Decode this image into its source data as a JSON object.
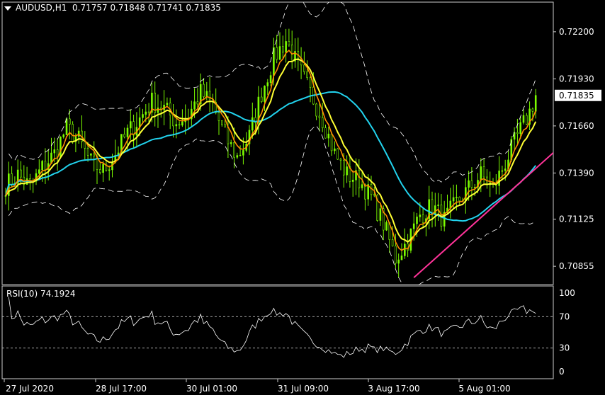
{
  "header": {
    "symbol": "AUDUSD,H1",
    "ohlc": "0.71757 0.71848 0.71741 0.71835"
  },
  "rsi_header": {
    "label": "RSI(10) 74.1924"
  },
  "colors": {
    "background": "#000000",
    "candle": "#7CFC00",
    "ma_fast": "#FF8C00",
    "ma_slow": "#FFFF33",
    "ma_long": "#22D3EE",
    "envelope": "#FFFFFF",
    "trendline": "#FF3399",
    "rsi": "#FFFFFF",
    "price_tag_bg": "#FFFFFF",
    "price_tag_text": "#000000"
  },
  "chart_data": [
    {
      "type": "candlestick",
      "title": "AUDUSD,H1",
      "y_ticks": [
        "0.72200",
        "0.71930",
        "0.71660",
        "0.71390",
        "0.71125",
        "0.70855"
      ],
      "ylim": [
        0.7075,
        0.7237
      ],
      "current_price": "0.71835",
      "x_ticks": [
        "27 Jul 2020",
        "28 Jul 17:00",
        "30 Jul 01:00",
        "31 Jul 09:00",
        "3 Aug 17:00",
        "5 Aug 01:00"
      ],
      "close_path": [
        [
          0,
          0.7132
        ],
        [
          4,
          0.7138
        ],
        [
          8,
          0.7131
        ],
        [
          12,
          0.7142
        ],
        [
          16,
          0.715
        ],
        [
          20,
          0.7165
        ],
        [
          24,
          0.7158
        ],
        [
          28,
          0.7145
        ],
        [
          32,
          0.714
        ],
        [
          36,
          0.715
        ],
        [
          40,
          0.7162
        ],
        [
          44,
          0.717
        ],
        [
          48,
          0.718
        ],
        [
          52,
          0.7176
        ],
        [
          56,
          0.7168
        ],
        [
          60,
          0.7172
        ],
        [
          64,
          0.7185
        ],
        [
          68,
          0.7178
        ],
        [
          72,
          0.716
        ],
        [
          76,
          0.7148
        ],
        [
          80,
          0.716
        ],
        [
          84,
          0.7185
        ],
        [
          88,
          0.7205
        ],
        [
          92,
          0.7215
        ],
        [
          96,
          0.72
        ],
        [
          100,
          0.7185
        ],
        [
          104,
          0.717
        ],
        [
          108,
          0.715
        ],
        [
          112,
          0.7138
        ],
        [
          116,
          0.7135
        ],
        [
          120,
          0.7125
        ],
        [
          124,
          0.711
        ],
        [
          128,
          0.709
        ],
        [
          132,
          0.71
        ],
        [
          136,
          0.7115
        ],
        [
          140,
          0.712
        ],
        [
          144,
          0.7112
        ],
        [
          148,
          0.7122
        ],
        [
          152,
          0.713
        ],
        [
          156,
          0.7138
        ],
        [
          160,
          0.713
        ],
        [
          164,
          0.7145
        ],
        [
          168,
          0.716
        ],
        [
          172,
          0.7174
        ],
        [
          174,
          0.71835
        ]
      ],
      "series": [
        {
          "kind": "ma_fast"
        },
        {
          "kind": "ma_slow"
        },
        {
          "kind": "ma_long"
        },
        {
          "kind": "envelope_upper"
        },
        {
          "kind": "envelope_lower"
        }
      ],
      "trendline": {
        "from": [
          134,
          0.7079
        ],
        "to": [
          196,
          0.7176
        ]
      }
    },
    {
      "type": "line",
      "title": "RSI(10) 74.1924",
      "y_ticks": [
        "100",
        "70",
        "30",
        "0"
      ],
      "ylim": [
        0,
        100
      ],
      "levels": [
        70,
        30
      ],
      "last_value": 74.1924
    }
  ]
}
